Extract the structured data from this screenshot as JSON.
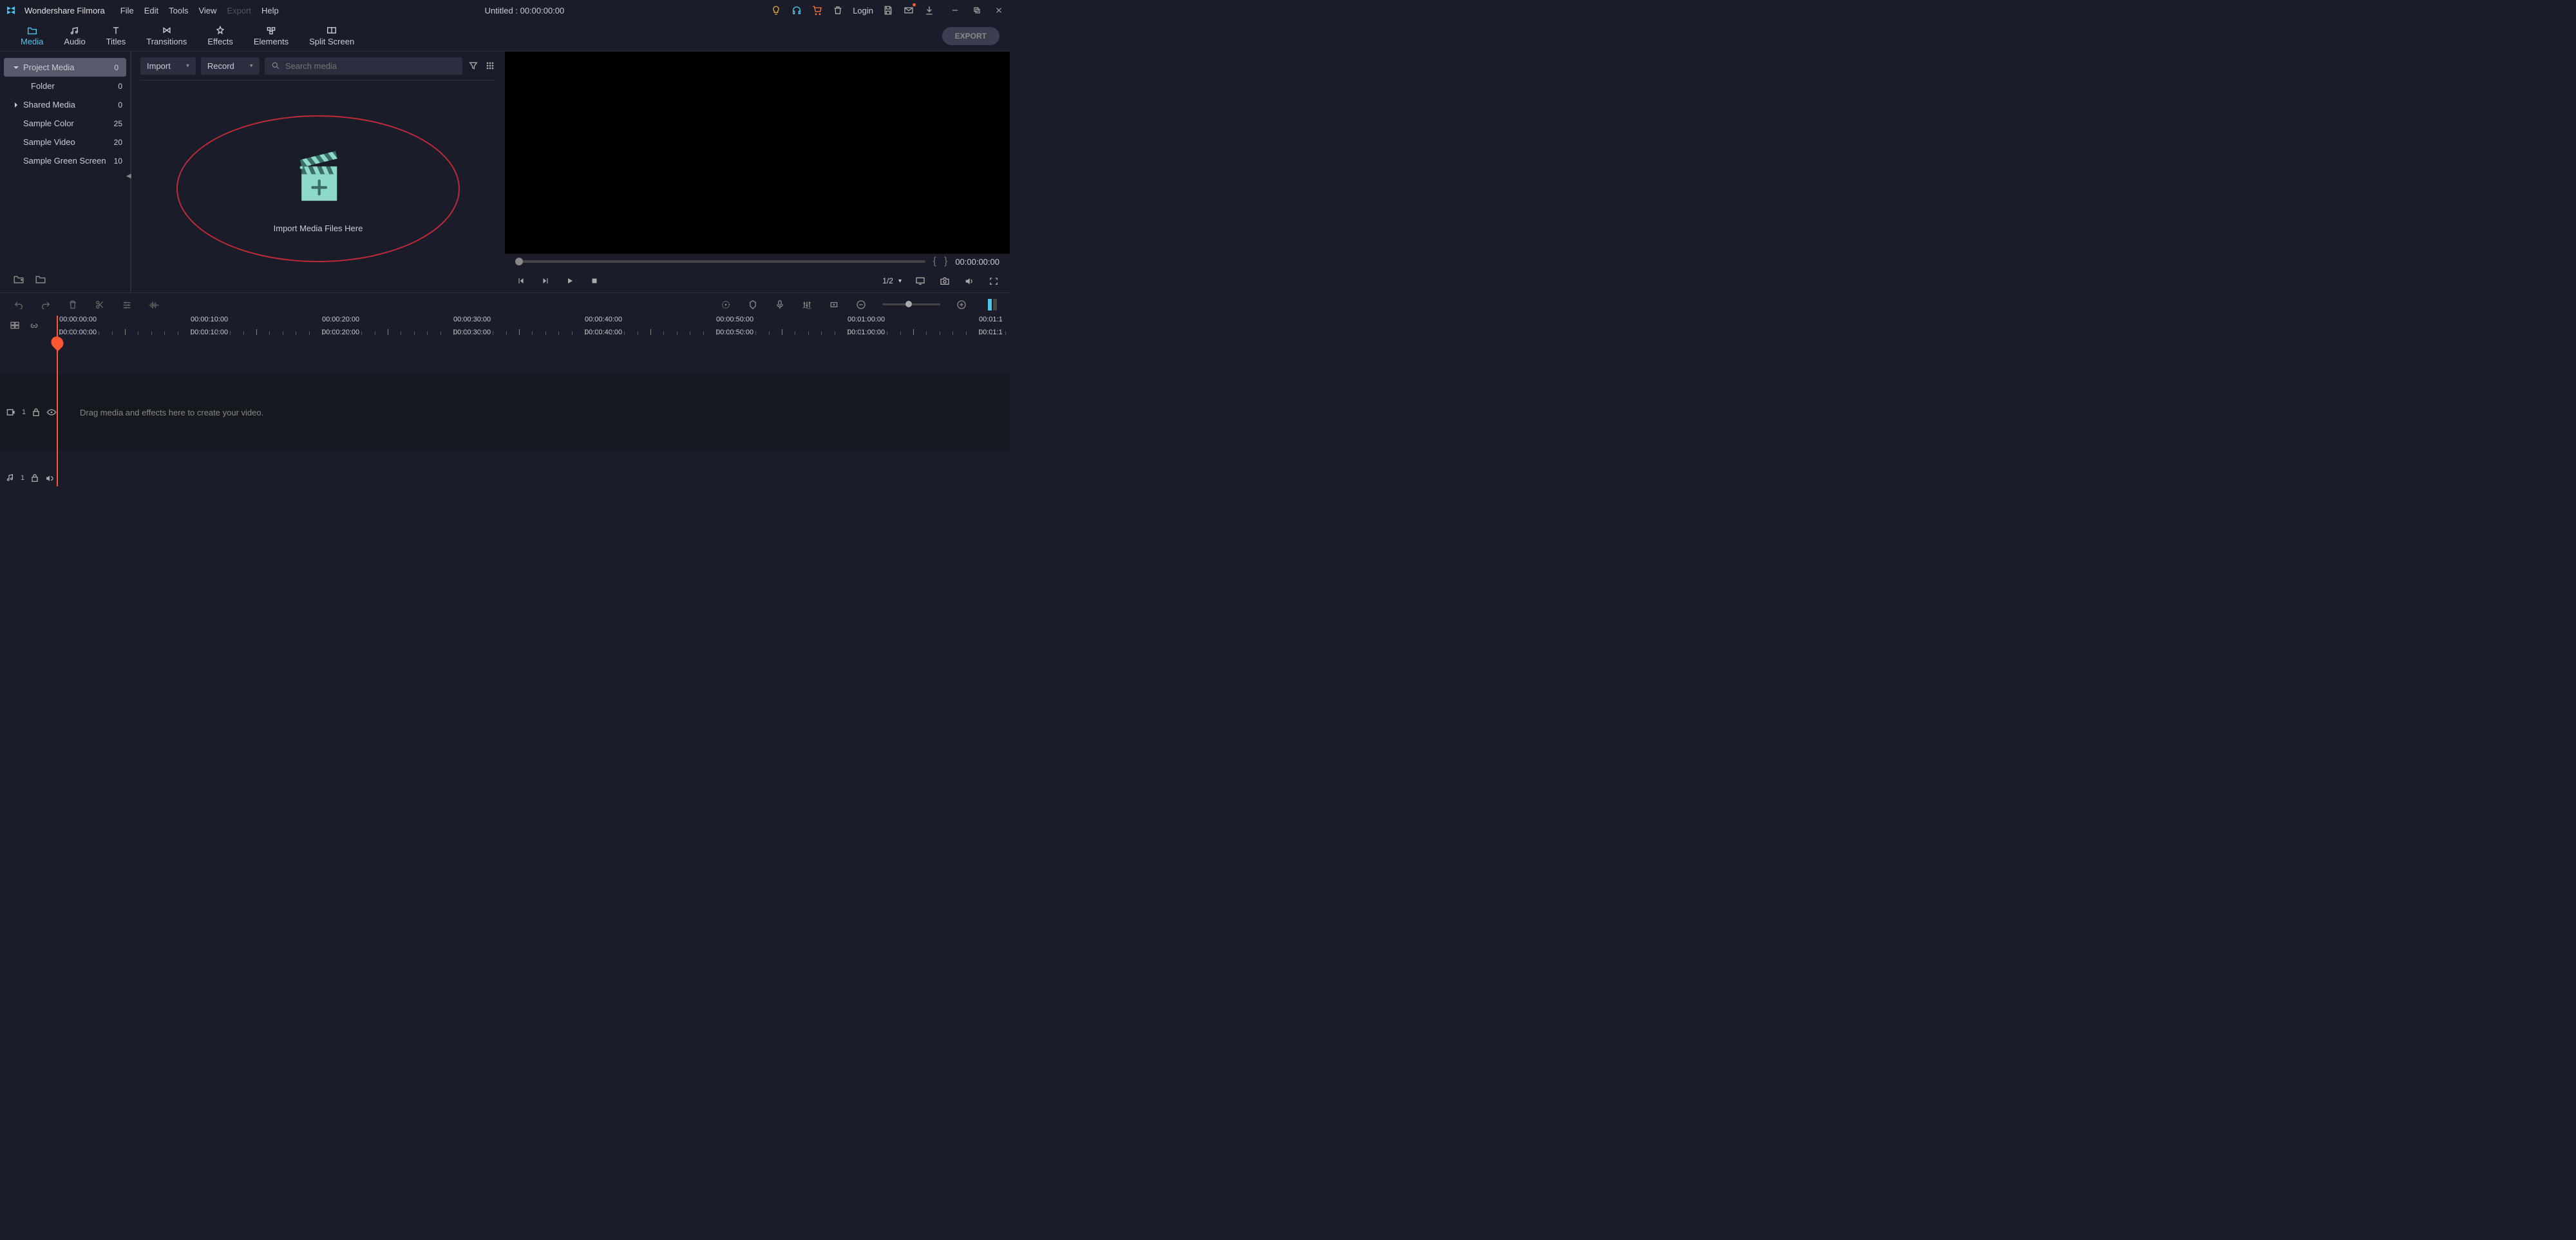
{
  "titlebar": {
    "app_name": "Wondershare Filmora",
    "menus": [
      "File",
      "Edit",
      "Tools",
      "View",
      "Export",
      "Help"
    ],
    "title": "Untitled : 00:00:00:00",
    "login": "Login"
  },
  "tabs": [
    "Media",
    "Audio",
    "Titles",
    "Transitions",
    "Effects",
    "Elements",
    "Split Screen"
  ],
  "export_label": "EXPORT",
  "sidebar": {
    "items": [
      {
        "label": "Project Media",
        "count": "0"
      },
      {
        "label": "Folder",
        "count": "0"
      },
      {
        "label": "Shared Media",
        "count": "0"
      },
      {
        "label": "Sample Color",
        "count": "25"
      },
      {
        "label": "Sample Video",
        "count": "20"
      },
      {
        "label": "Sample Green Screen",
        "count": "10"
      }
    ]
  },
  "media_toolbar": {
    "import": "Import",
    "record": "Record",
    "search_placeholder": "Search media"
  },
  "dropzone": {
    "text": "Import Media Files Here"
  },
  "preview": {
    "time": "00:00:00:00",
    "scale": "1/2"
  },
  "ruler": {
    "labels": [
      "00:00:00:00",
      "00:00:10:00",
      "00:00:20:00",
      "00:00:30:00",
      "00:00:40:00",
      "00:00:50:00",
      "00:01:00:00",
      "00:01:1"
    ]
  },
  "tracks": {
    "hint": "Drag media and effects here to create your video.",
    "video_index": "1",
    "audio_index": "1"
  }
}
